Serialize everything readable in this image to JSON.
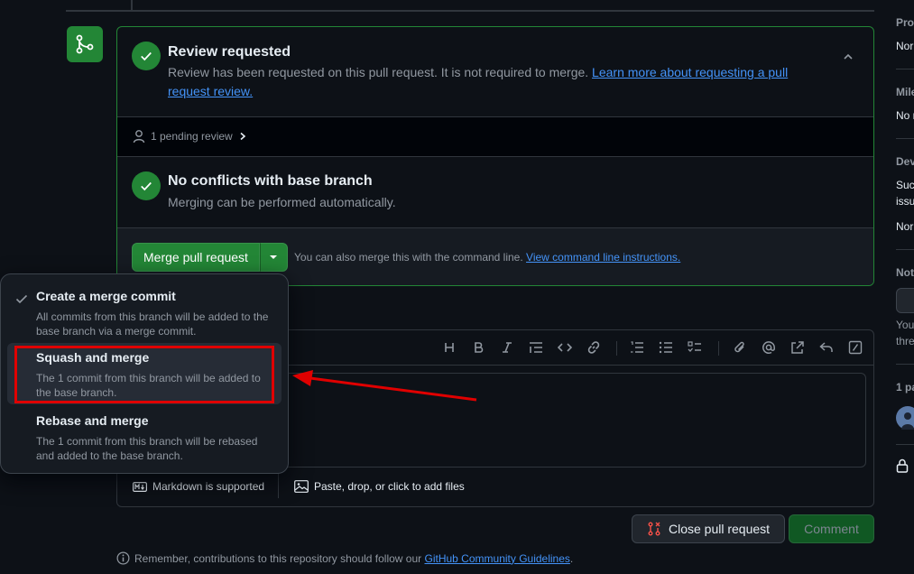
{
  "review": {
    "title": "Review requested",
    "desc": "Review has been requested on this pull request. It is not required to merge.",
    "link": "Learn more about requesting a pull request review.",
    "pending": "1 pending review"
  },
  "conflicts": {
    "title": "No conflicts with base branch",
    "desc": "Merging can be performed automatically."
  },
  "merge": {
    "button": "Merge pull request",
    "hint": "You can also merge this with the command line.",
    "hint_link": "View command line instructions."
  },
  "menu": {
    "items": [
      {
        "title": "Create a merge commit",
        "desc": "All commits from this branch will be added to the base branch via a merge commit."
      },
      {
        "title": "Squash and merge",
        "desc": "The 1 commit from this branch will be added to the base branch."
      },
      {
        "title": "Rebase and merge",
        "desc": "The 1 commit from this branch will be rebased and added to the base branch."
      }
    ]
  },
  "editor": {
    "markdown": "Markdown is supported",
    "attach": "Paste, drop, or click to add files"
  },
  "actions": {
    "close": "Close pull request",
    "comment": "Comment"
  },
  "footer": {
    "text": "Remember, contributions to this repository should follow our",
    "link": "GitHub Community Guidelines",
    "period": "."
  },
  "sidebar": {
    "projects_label": "Pro",
    "projects_val": "Nor",
    "milestone_label": "Mile",
    "milestone_val": "No r",
    "dev_label": "Dev",
    "dev_val_1": "Suc",
    "dev_val_2": "issu",
    "dev_val_3": "Nor",
    "notif_label": "Not",
    "notif_val_1": "You",
    "notif_val_2": "thre",
    "participants_label": "1 pa"
  },
  "colors": {
    "accent_green": "#238636",
    "link_blue": "#4493f8",
    "annotation_red": "#e00000",
    "close_icon_red": "#f85149"
  }
}
